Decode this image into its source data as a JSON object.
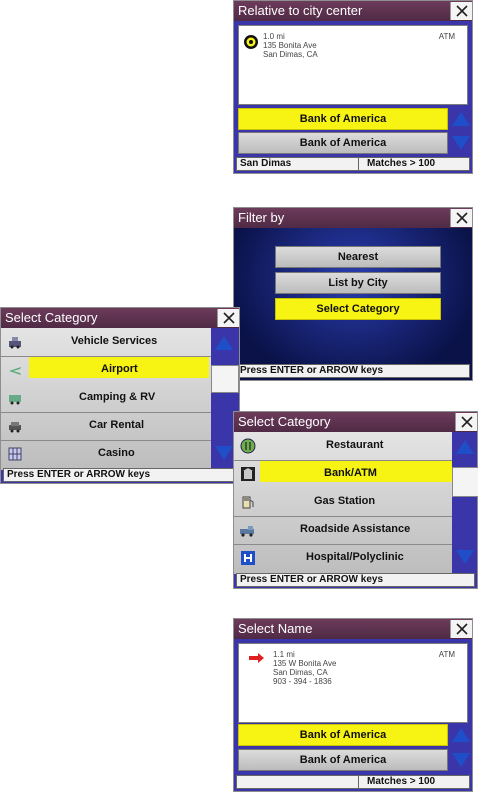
{
  "screen1": {
    "title": "Relative to city center",
    "distance": "1.0 mi",
    "type": "ATM",
    "address1": "135 Bonita Ave",
    "address2": "San Dimas, CA",
    "rows": [
      "Bank of America",
      "Bank of America"
    ],
    "status_city": "San Dimas",
    "status_matches": "Matches > 100"
  },
  "screen2": {
    "title": "Filter by",
    "options": [
      "Nearest",
      "List by City",
      "Select Category"
    ],
    "status": "Press ENTER or ARROW keys"
  },
  "screen3": {
    "title": "Select Category",
    "items": [
      "Vehicle Services",
      "Airport",
      "Camping & RV",
      "Car Rental",
      "Casino"
    ],
    "icons": [
      "car-service-icon",
      "airplane-icon",
      "camper-icon",
      "car-rental-icon",
      "casino-icon"
    ],
    "status": "Press ENTER or ARROW keys"
  },
  "screen4": {
    "title": "Select Category",
    "items": [
      "Restaurant",
      "Bank/ATM",
      "Gas Station",
      "Roadside Assistance",
      "Hospital/Polyclinic"
    ],
    "icons": [
      "restaurant-icon",
      "bank-icon",
      "gas-pump-icon",
      "tow-truck-icon",
      "hospital-icon"
    ],
    "status": "Press ENTER or ARROW keys"
  },
  "screen5": {
    "title": "Select Name",
    "distance": "1.1 mi",
    "type": "ATM",
    "address1": "135 W Bonita Ave",
    "address2": "San Dimas, CA",
    "phone": "903 - 394 - 1836",
    "rows": [
      "Bank of America",
      "Bank of America"
    ],
    "status_matches": "Matches > 100"
  },
  "colors": {
    "highlight": "#f7f313",
    "panel": "#3a35a8",
    "titlebar": "#5e3350"
  }
}
